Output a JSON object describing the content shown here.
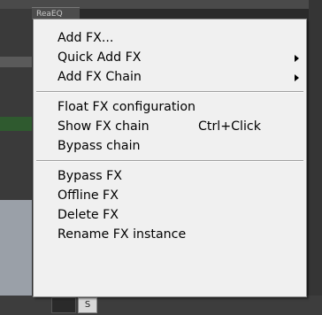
{
  "background": {
    "window_tab": "ReaEQ",
    "solo_button": "S"
  },
  "menu": {
    "group1": [
      {
        "label": "Add FX...",
        "submenu": false
      },
      {
        "label": "Quick Add FX",
        "submenu": true
      },
      {
        "label": "Add FX Chain",
        "submenu": true
      }
    ],
    "group2": [
      {
        "label": "Float FX configuration",
        "shortcut": ""
      },
      {
        "label": "Show FX chain",
        "shortcut": "Ctrl+Click"
      },
      {
        "label": "Bypass chain",
        "shortcut": ""
      }
    ],
    "group3": [
      {
        "label": "Bypass FX"
      },
      {
        "label": "Offline FX"
      },
      {
        "label": "Delete FX"
      },
      {
        "label": "Rename FX instance"
      }
    ]
  },
  "colors": {
    "menu_bg": "#f0f0f0",
    "menu_border": "#8a8a8a",
    "text": "#000000"
  }
}
